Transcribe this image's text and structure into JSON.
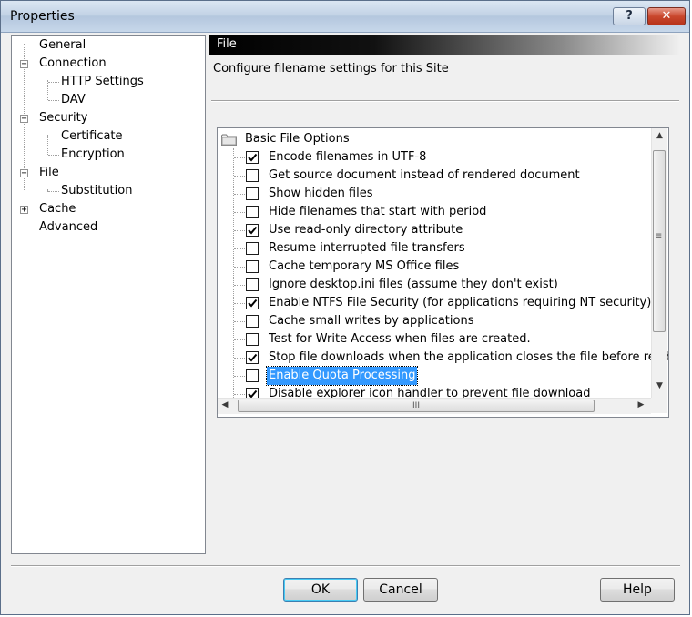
{
  "window": {
    "title": "Properties"
  },
  "titlebar": {
    "help_glyph": "?",
    "close_glyph": "✕"
  },
  "tree": {
    "items": [
      {
        "label": "General"
      },
      {
        "label": "Connection",
        "expander": "−"
      },
      {
        "label": "HTTP Settings"
      },
      {
        "label": "DAV"
      },
      {
        "label": "Security",
        "expander": "−"
      },
      {
        "label": "Certificate"
      },
      {
        "label": "Encryption"
      },
      {
        "label": "File",
        "expander": "−"
      },
      {
        "label": "Substitution"
      },
      {
        "label": "Cache",
        "expander": "+"
      },
      {
        "label": "Advanced"
      }
    ]
  },
  "panel": {
    "header": "File",
    "description": "Configure filename settings for this Site"
  },
  "options": {
    "group_label": "Basic File Options",
    "items": [
      {
        "label": "Encode filenames in UTF-8",
        "checked": true
      },
      {
        "label": "Get source document instead of rendered document",
        "checked": false
      },
      {
        "label": "Show hidden files",
        "checked": false
      },
      {
        "label": "Hide filenames that start with period",
        "checked": false
      },
      {
        "label": "Use read-only directory attribute",
        "checked": true
      },
      {
        "label": "Resume interrupted file transfers",
        "checked": false
      },
      {
        "label": "Cache temporary MS Office files",
        "checked": false
      },
      {
        "label": "Ignore desktop.ini files (assume they don't exist)",
        "checked": false
      },
      {
        "label": "Enable NTFS File Security (for applications requiring NT security)",
        "checked": true
      },
      {
        "label": "Cache small writes by applications",
        "checked": false
      },
      {
        "label": "Test for Write Access when files are created.",
        "checked": false
      },
      {
        "label": "Stop file downloads when the application closes the file before reading",
        "checked": true
      },
      {
        "label": "Enable Quota Processing",
        "checked": false,
        "selected": true
      },
      {
        "label": "Disable explorer icon handler to prevent file download",
        "checked": true
      }
    ]
  },
  "scrollbars": {
    "up": "▲",
    "down": "▼",
    "left": "◀",
    "right": "▶",
    "grip_v": "≡",
    "grip_h": "III"
  },
  "buttons": {
    "ok": "OK",
    "cancel": "Cancel",
    "help": "Help"
  }
}
